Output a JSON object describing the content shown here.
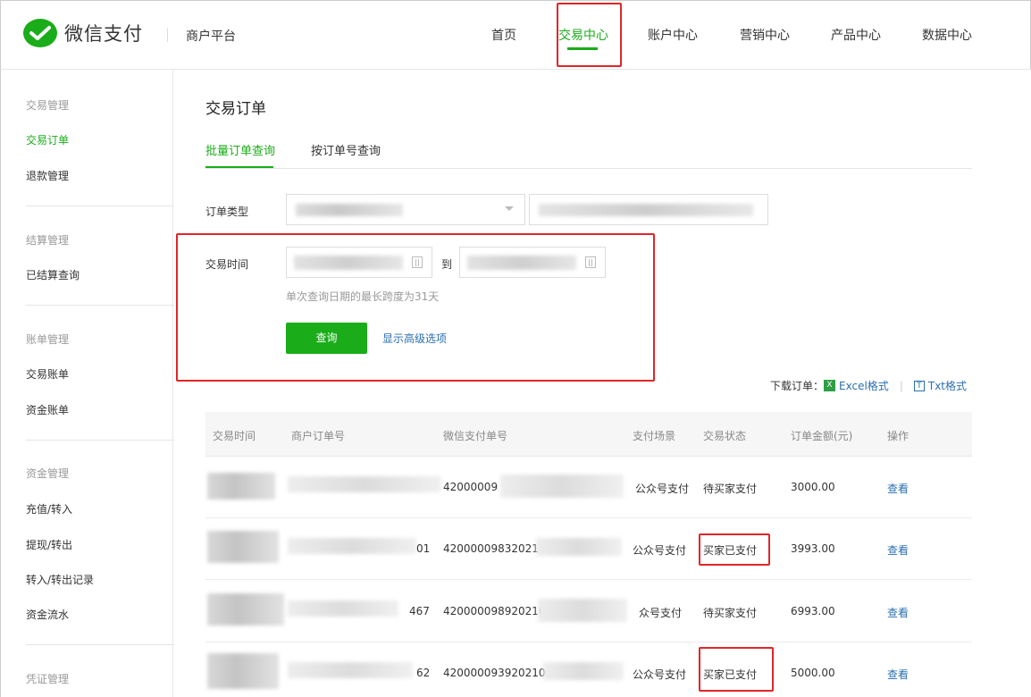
{
  "header": {
    "brand": "微信支付",
    "platform": "商户平台",
    "nav": [
      "首页",
      "交易中心",
      "账户中心",
      "营销中心",
      "产品中心",
      "数据中心"
    ],
    "active_nav": "交易中心"
  },
  "sidebar": {
    "groups": [
      {
        "title": "交易管理",
        "items": [
          "交易订单",
          "退款管理"
        ]
      },
      {
        "title": "结算管理",
        "items": [
          "已结算查询"
        ]
      },
      {
        "title": "账单管理",
        "items": [
          "交易账单",
          "资金账单"
        ]
      },
      {
        "title": "资金管理",
        "items": [
          "充值/转入",
          "提现/转出",
          "转入/转出记录",
          "资金流水"
        ]
      },
      {
        "title": "凭证管理",
        "items": []
      }
    ],
    "active_item": "交易订单"
  },
  "main": {
    "title": "交易订单",
    "tabs": [
      "批量订单查询",
      "按订单号查询"
    ],
    "form": {
      "order_type_label": "订单类型",
      "trade_time_label": "交易时间",
      "to_label": "到",
      "hint": "单次查询日期的最长跨度为31天",
      "query_button": "查询",
      "advanced_link": "显示高级选项"
    },
    "download": {
      "label": "下载订单：",
      "excel": "Excel格式",
      "txt": "Txt格式"
    },
    "table": {
      "headers": [
        "交易时间",
        "商户订单号",
        "微信支付单号",
        "支付场景",
        "交易状态",
        "订单金额(元)",
        "操作"
      ],
      "rows": [
        {
          "order_no_tail": "",
          "wx_no": "42000009",
          "scene": "公众号支付",
          "status": "待买家支付",
          "amount": "3000.00",
          "action": "查看"
        },
        {
          "order_no_tail": "01",
          "wx_no": "42000009832021",
          "scene": "公众号支付",
          "status": "买家已支付",
          "amount": "3993.00",
          "action": "查看"
        },
        {
          "order_no_tail": "467",
          "wx_no": "420000098920210",
          "scene": "众号支付",
          "status": "待买家支付",
          "amount": "6993.00",
          "action": "查看"
        },
        {
          "order_no_tail": "62",
          "wx_no": "4200000939202103",
          "scene": "公众号支付",
          "status": "买家已支付",
          "amount": "5000.00",
          "action": "查看"
        }
      ]
    }
  },
  "colors": {
    "brand_green": "#1aad19",
    "link_blue": "#2b6fb0",
    "highlight_red": "#e0262a"
  }
}
